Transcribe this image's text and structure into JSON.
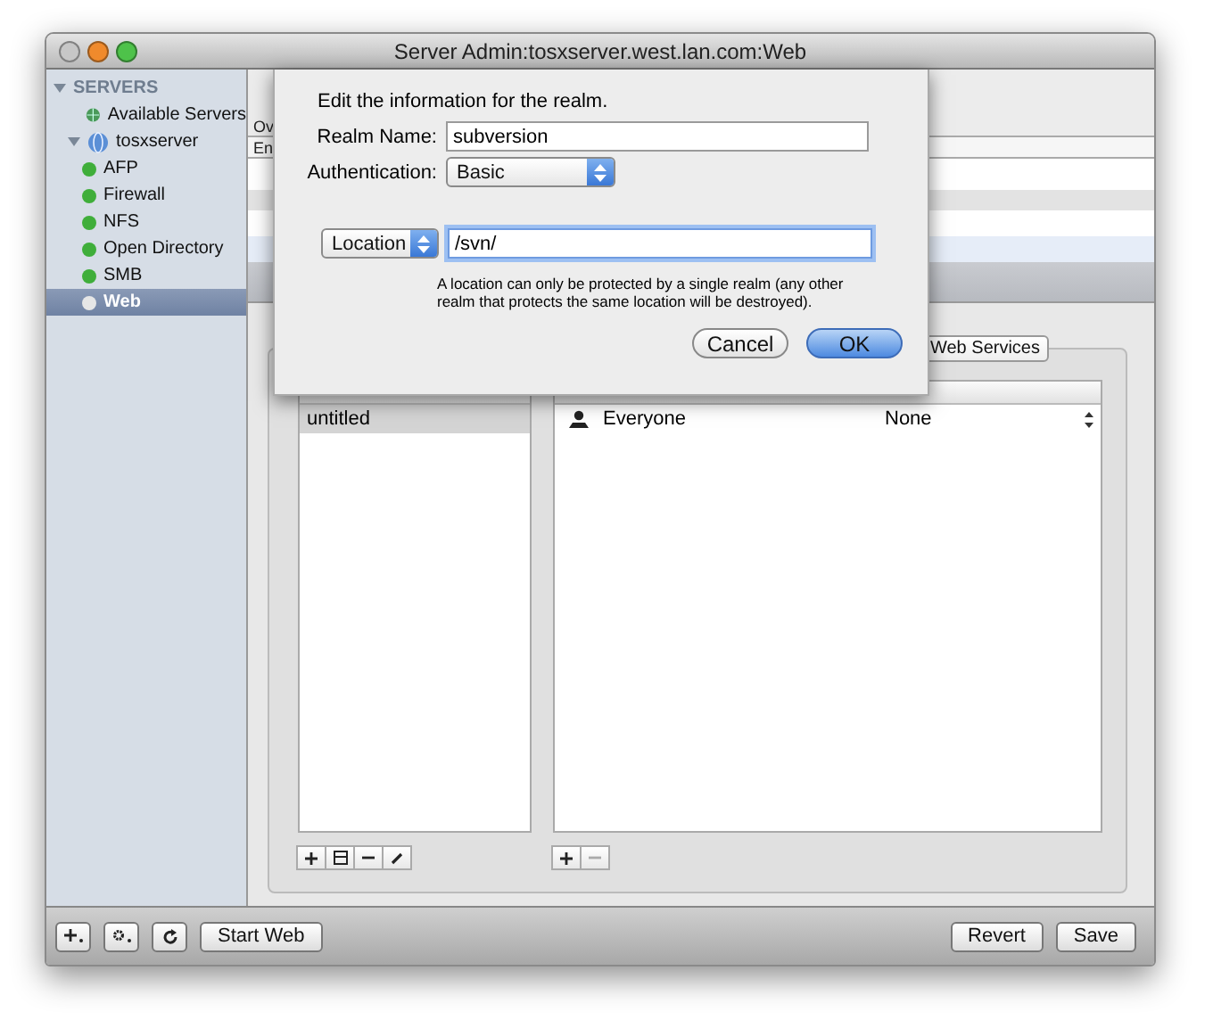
{
  "window": {
    "title": "Server Admin:tosxserver.west.lan.com:Web"
  },
  "sidebar": {
    "heading": "SERVERS",
    "expanded": true,
    "items": [
      {
        "label": "Available Servers",
        "kind": "globe",
        "selected": false
      },
      {
        "label": "tosxserver",
        "kind": "server",
        "selected": false,
        "expanded": true,
        "children": [
          {
            "label": "AFP",
            "kind": "service",
            "color": "#3fae3a",
            "selected": false
          },
          {
            "label": "Firewall",
            "kind": "service",
            "color": "#3fae3a",
            "selected": false
          },
          {
            "label": "NFS",
            "kind": "service",
            "color": "#3fae3a",
            "selected": false
          },
          {
            "label": "Open Directory",
            "kind": "service",
            "color": "#3fae3a",
            "selected": false
          },
          {
            "label": "SMB",
            "kind": "service",
            "color": "#3fae3a",
            "selected": false
          },
          {
            "label": "Web",
            "kind": "service",
            "color": "#e6e6e6",
            "selected": true
          }
        ]
      }
    ]
  },
  "background": {
    "tab_fragment": "Ov",
    "column_fragment": "En"
  },
  "tabs": [
    {
      "label": "Web Services",
      "selected": false
    }
  ],
  "realms": {
    "rows": [
      {
        "name": "untitled",
        "selected": true
      }
    ]
  },
  "access": {
    "rows": [
      {
        "user": "Everyone",
        "permission": "None"
      }
    ]
  },
  "sheet": {
    "heading": "Edit the information for the realm.",
    "realm_label": "Realm Name:",
    "realm_value": "subversion",
    "auth_label": "Authentication:",
    "auth_value": "Basic",
    "location_kind": "Location",
    "location_value": "/svn/",
    "note": "A location can only be protected by a single realm (any other realm that protects the same location will be destroyed).",
    "buttons": [
      {
        "label": "Cancel",
        "default": false
      },
      {
        "label": "OK",
        "default": true
      }
    ]
  },
  "bottom_bar": {
    "start_button": "Start Web",
    "right_buttons": [
      "Revert",
      "Save"
    ]
  }
}
